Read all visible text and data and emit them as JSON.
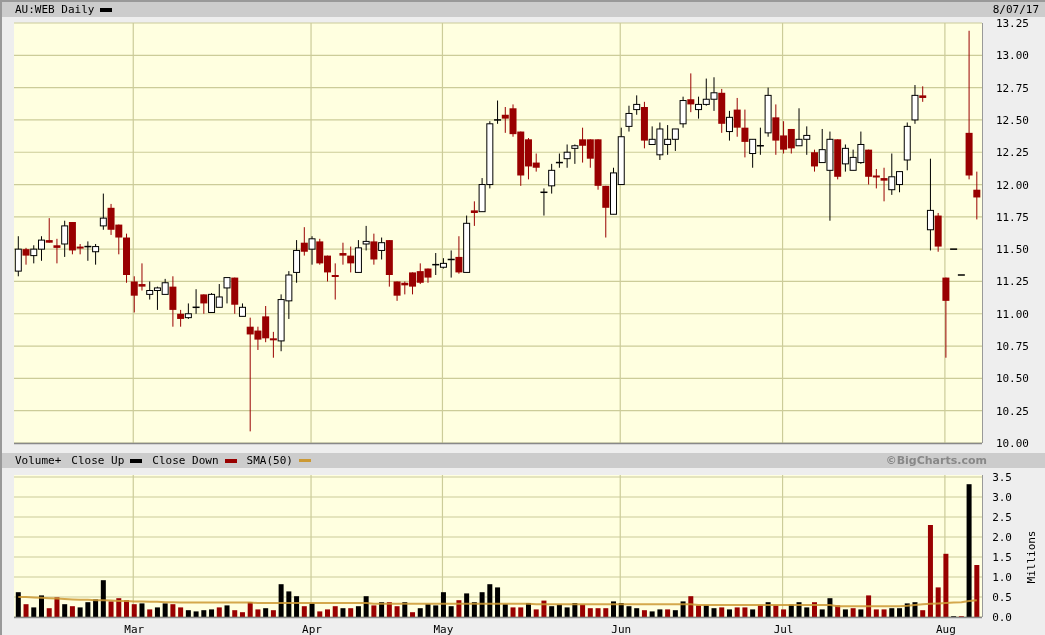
{
  "price_panel": {
    "date": "8/07/17",
    "chart_data": {
      "type": "candlestick",
      "title": "AU:WEB Daily",
      "grid": true,
      "ohlc": [
        [
          11.33,
          11.6,
          11.29,
          11.5
        ],
        [
          11.5,
          11.51,
          11.38,
          11.45
        ],
        [
          11.45,
          11.53,
          11.39,
          11.5
        ],
        [
          11.5,
          11.6,
          11.41,
          11.57
        ],
        [
          11.57,
          11.74,
          11.55,
          11.55
        ],
        [
          11.53,
          11.58,
          11.39,
          11.51
        ],
        [
          11.54,
          11.72,
          11.44,
          11.68
        ],
        [
          11.71,
          11.71,
          11.46,
          11.49
        ],
        [
          11.52,
          11.54,
          11.46,
          11.51
        ],
        [
          11.52,
          11.56,
          11.41,
          11.52
        ],
        [
          11.48,
          11.54,
          11.38,
          11.52
        ],
        [
          11.68,
          11.93,
          11.65,
          11.74
        ],
        [
          11.82,
          11.85,
          11.61,
          11.65
        ],
        [
          11.69,
          11.69,
          11.46,
          11.59
        ],
        [
          11.59,
          11.62,
          11.24,
          11.3
        ],
        [
          11.25,
          11.29,
          11.01,
          11.14
        ],
        [
          11.23,
          11.39,
          11.18,
          11.21
        ],
        [
          11.15,
          11.25,
          11.11,
          11.18
        ],
        [
          11.18,
          11.21,
          11.03,
          11.2
        ],
        [
          11.15,
          11.27,
          11.15,
          11.24
        ],
        [
          11.21,
          11.29,
          10.9,
          11.03
        ],
        [
          11.0,
          11.03,
          10.9,
          10.96
        ],
        [
          10.97,
          11.08,
          10.96,
          11.0
        ],
        [
          11.05,
          11.19,
          11.0,
          11.05
        ],
        [
          11.15,
          11.15,
          11.0,
          11.08
        ],
        [
          11.01,
          11.16,
          11.01,
          11.15
        ],
        [
          11.05,
          11.23,
          11.05,
          11.13
        ],
        [
          11.2,
          11.28,
          11.08,
          11.28
        ],
        [
          11.28,
          11.28,
          11.0,
          11.07
        ],
        [
          10.98,
          11.08,
          10.98,
          11.05
        ],
        [
          10.9,
          10.97,
          10.09,
          10.84
        ],
        [
          10.87,
          10.9,
          10.72,
          10.8
        ],
        [
          10.98,
          11.06,
          10.78,
          10.81
        ],
        [
          10.81,
          10.86,
          10.66,
          10.8
        ],
        [
          10.79,
          11.15,
          10.71,
          11.11
        ],
        [
          11.1,
          11.33,
          10.96,
          11.3
        ],
        [
          11.32,
          11.57,
          11.24,
          11.49
        ],
        [
          11.55,
          11.67,
          11.45,
          11.48
        ],
        [
          11.5,
          11.6,
          11.38,
          11.58
        ],
        [
          11.56,
          11.58,
          11.38,
          11.39
        ],
        [
          11.45,
          11.45,
          11.25,
          11.32
        ],
        [
          11.3,
          11.39,
          11.11,
          11.29
        ],
        [
          11.47,
          11.55,
          11.38,
          11.45
        ],
        [
          11.45,
          11.52,
          11.32,
          11.39
        ],
        [
          11.32,
          11.57,
          11.32,
          11.51
        ],
        [
          11.54,
          11.68,
          11.49,
          11.56
        ],
        [
          11.56,
          11.62,
          11.38,
          11.42
        ],
        [
          11.49,
          11.59,
          11.42,
          11.55
        ],
        [
          11.57,
          11.57,
          11.21,
          11.3
        ],
        [
          11.25,
          11.25,
          11.1,
          11.14
        ],
        [
          11.24,
          11.25,
          11.15,
          11.22
        ],
        [
          11.32,
          11.32,
          11.15,
          11.21
        ],
        [
          11.33,
          11.39,
          11.23,
          11.24
        ],
        [
          11.35,
          11.35,
          11.24,
          11.28
        ],
        [
          11.38,
          11.47,
          11.3,
          11.38
        ],
        [
          11.36,
          11.43,
          11.35,
          11.39
        ],
        [
          11.42,
          11.49,
          11.28,
          11.42
        ],
        [
          11.44,
          11.6,
          11.31,
          11.32
        ],
        [
          11.32,
          11.76,
          11.32,
          11.7
        ],
        [
          11.8,
          11.87,
          11.68,
          11.78
        ],
        [
          11.79,
          12.05,
          11.79,
          12.0
        ],
        [
          12.0,
          12.49,
          11.97,
          12.47
        ],
        [
          12.5,
          12.65,
          12.47,
          12.5
        ],
        [
          12.54,
          12.6,
          12.4,
          12.51
        ],
        [
          12.59,
          12.62,
          12.37,
          12.39
        ],
        [
          12.41,
          12.41,
          11.99,
          12.07
        ],
        [
          12.35,
          12.36,
          12.04,
          12.14
        ],
        [
          12.17,
          12.24,
          12.1,
          12.13
        ],
        [
          11.94,
          11.97,
          11.76,
          11.94
        ],
        [
          11.99,
          12.16,
          11.93,
          12.11
        ],
        [
          12.17,
          12.24,
          12.13,
          12.17
        ],
        [
          12.2,
          12.31,
          12.13,
          12.25
        ],
        [
          12.28,
          12.31,
          12.16,
          12.3
        ],
        [
          12.35,
          12.44,
          12.17,
          12.3
        ],
        [
          12.35,
          12.35,
          12.13,
          12.2
        ],
        [
          12.35,
          12.35,
          11.96,
          11.99
        ],
        [
          11.99,
          11.99,
          11.59,
          11.82
        ],
        [
          11.77,
          12.13,
          11.77,
          12.09
        ],
        [
          12.0,
          12.44,
          12.0,
          12.37
        ],
        [
          12.45,
          12.61,
          12.41,
          12.55
        ],
        [
          12.58,
          12.69,
          12.54,
          12.62
        ],
        [
          12.6,
          12.64,
          12.28,
          12.34
        ],
        [
          12.31,
          12.45,
          12.31,
          12.35
        ],
        [
          12.23,
          12.48,
          12.19,
          12.43
        ],
        [
          12.31,
          12.46,
          12.23,
          12.35
        ],
        [
          12.35,
          12.43,
          12.26,
          12.43
        ],
        [
          12.47,
          12.68,
          12.44,
          12.65
        ],
        [
          12.66,
          12.86,
          12.56,
          12.62
        ],
        [
          12.58,
          12.68,
          12.51,
          12.62
        ],
        [
          12.62,
          12.82,
          12.61,
          12.66
        ],
        [
          12.66,
          12.83,
          12.57,
          12.71
        ],
        [
          12.71,
          12.74,
          12.4,
          12.47
        ],
        [
          12.41,
          12.57,
          12.34,
          12.52
        ],
        [
          12.58,
          12.67,
          12.37,
          12.44
        ],
        [
          12.44,
          12.58,
          12.21,
          12.33
        ],
        [
          12.24,
          12.35,
          12.13,
          12.35
        ],
        [
          12.3,
          12.44,
          12.23,
          12.3
        ],
        [
          12.4,
          12.75,
          12.37,
          12.69
        ],
        [
          12.52,
          12.62,
          12.23,
          12.34
        ],
        [
          12.38,
          12.49,
          12.24,
          12.27
        ],
        [
          12.43,
          12.43,
          12.24,
          12.28
        ],
        [
          12.3,
          12.59,
          12.3,
          12.35
        ],
        [
          12.35,
          12.45,
          12.23,
          12.38
        ],
        [
          12.25,
          12.27,
          12.1,
          12.14
        ],
        [
          12.17,
          12.43,
          12.17,
          12.27
        ],
        [
          12.11,
          12.41,
          11.72,
          12.35
        ],
        [
          12.35,
          12.35,
          12.04,
          12.06
        ],
        [
          12.16,
          12.31,
          12.1,
          12.28
        ],
        [
          12.11,
          12.27,
          12.11,
          12.21
        ],
        [
          12.17,
          12.41,
          12.16,
          12.31
        ],
        [
          12.27,
          12.27,
          12.0,
          12.06
        ],
        [
          12.07,
          12.12,
          11.97,
          12.06
        ],
        [
          12.05,
          12.13,
          11.87,
          12.03
        ],
        [
          11.96,
          12.24,
          11.92,
          12.06
        ],
        [
          12.0,
          12.1,
          11.94,
          12.1
        ],
        [
          12.19,
          12.48,
          12.11,
          12.45
        ],
        [
          12.5,
          12.77,
          12.47,
          12.69
        ],
        [
          12.69,
          12.76,
          12.64,
          12.67
        ],
        [
          11.65,
          12.2,
          11.49,
          11.8
        ],
        [
          11.76,
          11.78,
          11.48,
          11.52
        ],
        [
          11.28,
          11.28,
          10.66,
          11.1
        ],
        [
          11.5,
          11.5,
          11.5,
          11.5
        ],
        [
          11.3,
          11.3,
          11.3,
          11.3
        ],
        [
          12.4,
          13.19,
          12.04,
          12.07
        ],
        [
          11.96,
          12.1,
          11.73,
          11.9
        ]
      ],
      "ylim": [
        10.0,
        13.25
      ],
      "yticks": [
        {
          "value": 10,
          "label": "10.00"
        },
        {
          "value": 10.25,
          "label": "10.25"
        },
        {
          "value": 10.5,
          "label": "10.50"
        },
        {
          "value": 10.75,
          "label": "10.75"
        },
        {
          "value": 11,
          "label": "11.00"
        },
        {
          "value": 11.25,
          "label": "11.25"
        },
        {
          "value": 11.5,
          "label": "11.50"
        },
        {
          "value": 11.75,
          "label": "11.75"
        },
        {
          "value": 12,
          "label": "12.00"
        },
        {
          "value": 12.25,
          "label": "12.25"
        },
        {
          "value": 12.5,
          "label": "12.50"
        },
        {
          "value": 12.75,
          "label": "12.75"
        },
        {
          "value": 13,
          "label": "13.00"
        },
        {
          "value": 13.25,
          "label": "13.25"
        }
      ]
    }
  },
  "volume_panel": {
    "copyright": "©BigCharts.com",
    "chart_data": {
      "type": "bar",
      "title": "Volume+",
      "ylabel": "Millions",
      "grid": true,
      "categories": [
        null,
        null,
        null,
        null,
        null,
        null,
        null,
        null,
        null,
        null,
        null,
        null,
        null,
        null,
        null,
        "Mar",
        null,
        null,
        null,
        null,
        null,
        null,
        null,
        null,
        null,
        null,
        null,
        null,
        null,
        null,
        null,
        null,
        null,
        null,
        null,
        null,
        null,
        null,
        "Apr",
        null,
        null,
        null,
        null,
        null,
        null,
        null,
        null,
        null,
        null,
        null,
        null,
        null,
        null,
        null,
        null,
        "May",
        null,
        null,
        null,
        null,
        null,
        null,
        null,
        null,
        null,
        null,
        null,
        null,
        null,
        null,
        null,
        null,
        null,
        null,
        null,
        null,
        null,
        null,
        "Jun",
        null,
        null,
        null,
        null,
        null,
        null,
        null,
        null,
        null,
        null,
        null,
        null,
        null,
        null,
        null,
        null,
        null,
        null,
        null,
        null,
        "Jul",
        null,
        null,
        null,
        null,
        null,
        null,
        null,
        null,
        null,
        null,
        null,
        null,
        null,
        null,
        null,
        null,
        null,
        null,
        null,
        null,
        "Aug",
        null,
        null,
        null,
        null
      ],
      "series": [
        {
          "name": "Close Up",
          "color": "#000000",
          "values": [
            0.62,
            null,
            0.24,
            0.54,
            null,
            null,
            0.32,
            null,
            0.24,
            0.37,
            0.44,
            0.92,
            null,
            null,
            null,
            null,
            0.34,
            null,
            0.24,
            0.34,
            null,
            null,
            0.17,
            0.14,
            0.17,
            0.19,
            null,
            0.29,
            null,
            null,
            null,
            null,
            0.22,
            null,
            0.82,
            0.64,
            0.52,
            null,
            0.34,
            null,
            null,
            null,
            0.22,
            null,
            0.27,
            0.52,
            null,
            0.37,
            null,
            null,
            0.37,
            null,
            0.22,
            0.32,
            0.29,
            0.62,
            0.27,
            null,
            0.59,
            0.37,
            0.62,
            0.82,
            0.74,
            0.32,
            null,
            null,
            0.35,
            null,
            null,
            0.27,
            0.31,
            0.24,
            0.35,
            null,
            null,
            null,
            null,
            0.39,
            0.35,
            0.27,
            0.22,
            null,
            0.14,
            0.19,
            null,
            0.17,
            0.39,
            null,
            null,
            0.29,
            0.22,
            null,
            0.19,
            null,
            null,
            0.19,
            null,
            0.37,
            null,
            null,
            0.31,
            0.37,
            0.24,
            null,
            0.19,
            0.47,
            null,
            0.19,
            null,
            0.19,
            null,
            null,
            null,
            0.22,
            0.22,
            0.34,
            0.37,
            null,
            null,
            null,
            null,
            0.02,
            null,
            3.32,
            null
          ]
        },
        {
          "name": "Close Down",
          "color": "#990000",
          "values": [
            null,
            0.32,
            null,
            null,
            0.22,
            0.49,
            null,
            0.27,
            null,
            null,
            null,
            null,
            0.39,
            0.47,
            0.42,
            0.32,
            null,
            0.19,
            null,
            null,
            0.32,
            0.24,
            null,
            null,
            null,
            null,
            0.24,
            null,
            0.17,
            0.12,
            0.37,
            0.19,
            null,
            0.17,
            null,
            null,
            null,
            0.27,
            null,
            0.14,
            0.19,
            0.27,
            null,
            0.22,
            null,
            null,
            0.29,
            null,
            0.37,
            0.27,
            null,
            0.12,
            null,
            null,
            null,
            null,
            null,
            0.42,
            null,
            null,
            null,
            null,
            null,
            null,
            0.24,
            0.24,
            null,
            0.19,
            0.41,
            null,
            null,
            null,
            null,
            0.31,
            0.22,
            0.22,
            0.22,
            null,
            null,
            null,
            null,
            0.17,
            null,
            null,
            0.19,
            null,
            null,
            0.52,
            0.29,
            null,
            null,
            0.24,
            null,
            0.24,
            0.24,
            null,
            0.29,
            null,
            0.29,
            0.19,
            null,
            null,
            null,
            0.37,
            null,
            null,
            0.29,
            null,
            0.22,
            null,
            0.54,
            0.19,
            0.19,
            null,
            null,
            null,
            null,
            0.17,
            2.3,
            0.74,
            1.58,
            null,
            0.02,
            null,
            1.3
          ]
        },
        {
          "name": "SMA(50)",
          "color": "#cc9933",
          "type": "line",
          "values": [
            0.5,
            0.5,
            0.49,
            0.48,
            0.47,
            0.46,
            0.45,
            0.44,
            0.43,
            0.43,
            0.42,
            0.42,
            0.41,
            0.4,
            0.4,
            0.39,
            0.39,
            0.38,
            0.38,
            0.37,
            0.37,
            0.36,
            0.36,
            0.36,
            0.36,
            0.36,
            0.36,
            0.36,
            0.36,
            0.36,
            0.36,
            0.35,
            0.35,
            0.35,
            0.35,
            0.35,
            0.35,
            0.35,
            0.35,
            0.35,
            0.35,
            0.35,
            0.35,
            0.35,
            0.35,
            0.35,
            0.33,
            0.33,
            0.33,
            0.33,
            0.33,
            0.33,
            0.33,
            0.33,
            0.33,
            0.33,
            0.33,
            0.33,
            0.33,
            0.33,
            0.33,
            0.33,
            0.33,
            0.33,
            0.33,
            0.33,
            0.33,
            0.32,
            0.32,
            0.32,
            0.32,
            0.32,
            0.32,
            0.32,
            0.32,
            0.32,
            0.32,
            0.32,
            0.32,
            0.32,
            0.32,
            0.32,
            0.32,
            0.32,
            0.32,
            0.32,
            0.32,
            0.32,
            0.3,
            0.3,
            0.3,
            0.3,
            0.3,
            0.3,
            0.3,
            0.3,
            0.3,
            0.3,
            0.3,
            0.3,
            0.3,
            0.3,
            0.3,
            0.3,
            0.3,
            0.3,
            0.27,
            0.27,
            0.27,
            0.27,
            0.27,
            0.27,
            0.27,
            0.27,
            0.27,
            0.28,
            0.3,
            0.32,
            0.33,
            0.34,
            0.35,
            0.36,
            0.37,
            0.4,
            0.42
          ]
        }
      ],
      "ylim": [
        0,
        3.5
      ],
      "yticks": [
        {
          "value": 0,
          "label": "0.0"
        },
        {
          "value": 0.5,
          "label": "0.5"
        },
        {
          "value": 1,
          "label": "1.0"
        },
        {
          "value": 1.5,
          "label": "1.5"
        },
        {
          "value": 2,
          "label": "2.0"
        },
        {
          "value": 2.5,
          "label": "2.5"
        },
        {
          "value": 3,
          "label": "3.0"
        },
        {
          "value": 3.5,
          "label": "3.5"
        }
      ]
    }
  }
}
